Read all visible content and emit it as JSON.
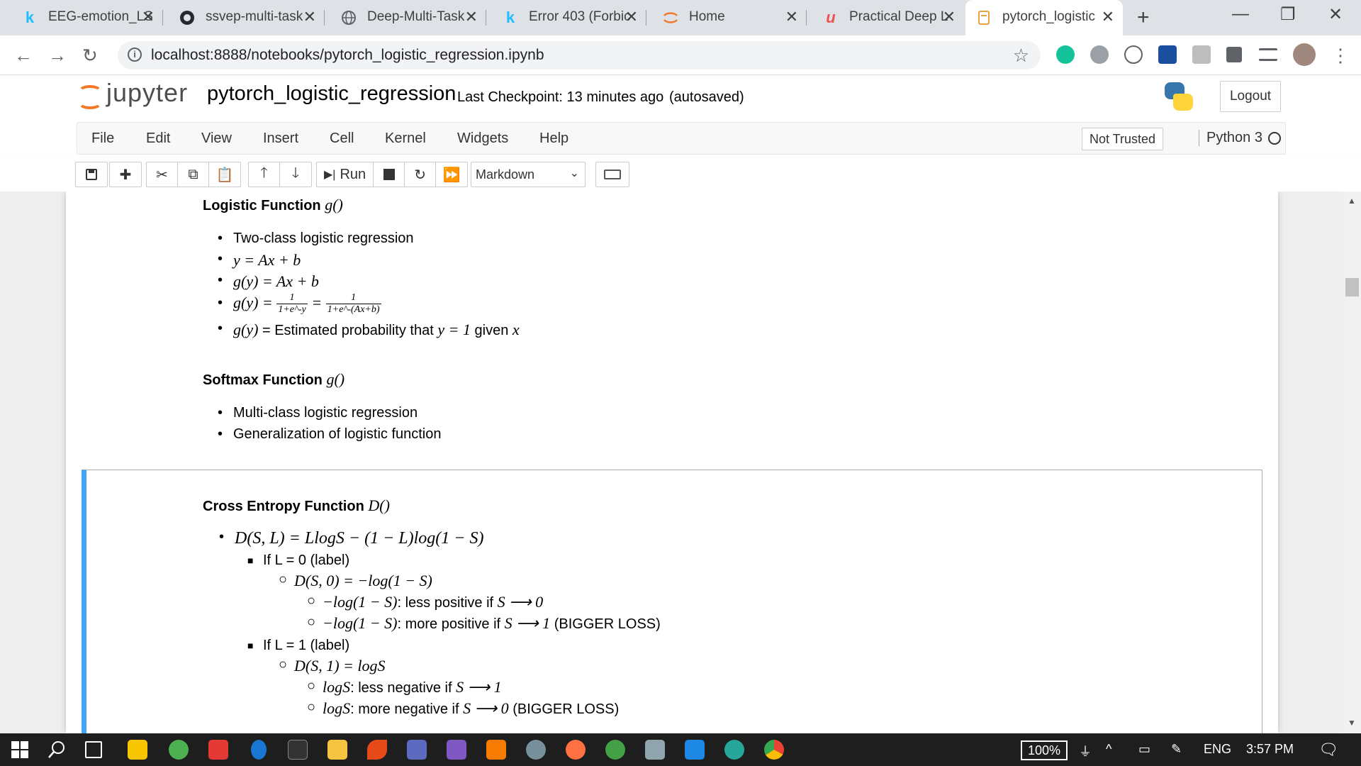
{
  "browser": {
    "tabs": [
      {
        "title": "EEG-emotion_LS",
        "icon": "kaggle-icon"
      },
      {
        "title": "ssvep-multi-task",
        "icon": "github-icon"
      },
      {
        "title": "Deep-Multi-Task",
        "icon": "globe-icon"
      },
      {
        "title": "Error 403 (Forbic",
        "icon": "kaggle-icon"
      },
      {
        "title": "Home",
        "icon": "jupyter-icon"
      },
      {
        "title": "Practical Deep L",
        "icon": "udemy-icon"
      },
      {
        "title": "pytorch_logistic",
        "icon": "notebook-icon",
        "active": true
      }
    ],
    "url": "localhost:8888/notebooks/pytorch_logistic_regression.ipynb"
  },
  "jupyter": {
    "brand": "jupyter",
    "notebook_name": "pytorch_logistic_regression",
    "checkpoint": "Last Checkpoint: 13 minutes ago",
    "autosave": "(autosaved)",
    "logout": "Logout",
    "menu": [
      "File",
      "Edit",
      "View",
      "Insert",
      "Cell",
      "Kernel",
      "Widgets",
      "Help"
    ],
    "trust": "Not Trusted",
    "kernel": "Python 3",
    "run_label": "Run",
    "cell_type": "Markdown"
  },
  "content": {
    "logistic": {
      "heading": "Logistic Function",
      "heading_math": "g()",
      "items": [
        {
          "kind": "text",
          "text": "Two-class logistic regression"
        },
        {
          "kind": "math",
          "text": "y = Ax + b"
        },
        {
          "kind": "math",
          "text": "g(y) = Ax + b"
        }
      ],
      "sigmoid_prefix": "g(y) =",
      "sigmoid_f1_num": "1",
      "sigmoid_f1_den": "1+e^-y",
      "sigmoid_eq": "=",
      "sigmoid_f2_num": "1",
      "sigmoid_f2_den": "1+e^-(Ax+b)",
      "prob_math": "g(y)",
      "prob_text": "= Estimated probability that",
      "prob_cond": "y = 1",
      "prob_given": "given",
      "prob_var": "x"
    },
    "softmax": {
      "heading": "Softmax Function",
      "heading_math": "g()",
      "items": [
        "Multi-class logistic regression",
        "Generalization of logistic function"
      ]
    },
    "cross_entropy": {
      "heading": "Cross Entropy Function",
      "heading_math": "D()",
      "formula": "D(S, L) = LlogS − (1 − L)log(1 − S)",
      "label0": "If L = 0 (label)",
      "label0_formula": "D(S, 0) = −log(1 − S)",
      "label0_a_math": "−log(1 − S)",
      "label0_a_text": ": less positive if",
      "label0_a_limit": "S ⟶ 0",
      "label0_b_math": "−log(1 − S)",
      "label0_b_text": ": more positive if",
      "label0_b_limit": "S ⟶ 1",
      "label0_b_note": "(BIGGER LOSS)",
      "label1": "If L = 1 (label)",
      "label1_formula": "D(S, 1) = logS",
      "label1_a_math": "logS",
      "label1_a_text": ": less negative if",
      "label1_a_limit": "S ⟶ 1",
      "label1_b_math": "logS",
      "label1_b_text": ": more negative if",
      "label1_b_limit": "S ⟶ 0",
      "label1_b_note": "(BIGGER LOSS)"
    }
  },
  "taskbar": {
    "zoom": "100%",
    "lang": "ENG",
    "time": "3:57 PM"
  },
  "colors": {
    "jupyter_orange": "#f37726",
    "cell_selected": "#42a5f5",
    "taskbar": "#1e1e1e"
  }
}
